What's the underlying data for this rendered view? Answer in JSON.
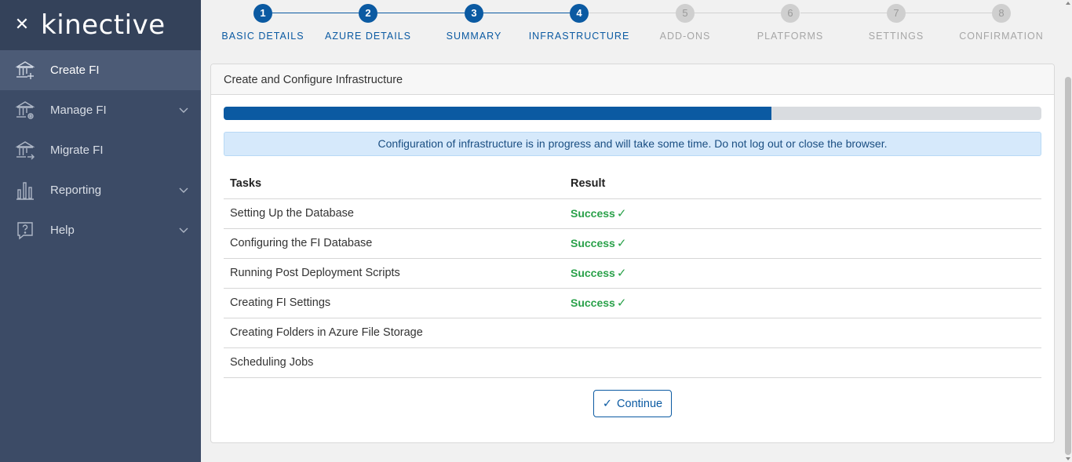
{
  "app": {
    "logo": "kinective"
  },
  "sidebar": {
    "items": [
      {
        "label": "Create FI",
        "icon": "bank-plus-icon",
        "active": true,
        "expandable": false
      },
      {
        "label": "Manage FI",
        "icon": "bank-gear-icon",
        "active": false,
        "expandable": true
      },
      {
        "label": "Migrate FI",
        "icon": "bank-arrow-icon",
        "active": false,
        "expandable": false
      },
      {
        "label": "Reporting",
        "icon": "bar-chart-icon",
        "active": false,
        "expandable": true
      },
      {
        "label": "Help",
        "icon": "help-bubble-icon",
        "active": false,
        "expandable": true
      }
    ]
  },
  "stepper": {
    "steps": [
      {
        "number": "1",
        "label": "BASIC DETAILS",
        "state": "done"
      },
      {
        "number": "2",
        "label": "AZURE DETAILS",
        "state": "done"
      },
      {
        "number": "3",
        "label": "SUMMARY",
        "state": "done"
      },
      {
        "number": "4",
        "label": "INFRASTRUCTURE",
        "state": "done"
      },
      {
        "number": "5",
        "label": "ADD-ONS",
        "state": "todo"
      },
      {
        "number": "6",
        "label": "PLATFORMS",
        "state": "todo"
      },
      {
        "number": "7",
        "label": "SETTINGS",
        "state": "todo"
      },
      {
        "number": "8",
        "label": "CONFIRMATION",
        "state": "todo"
      }
    ]
  },
  "card": {
    "title": "Create and Configure Infrastructure",
    "progress_fraction": 0.67,
    "alert": "Configuration of infrastructure is in progress and will take some time. Do not log out or close the browser.",
    "table": {
      "headers": {
        "task": "Tasks",
        "result": "Result"
      },
      "rows": [
        {
          "task": "Setting Up the Database",
          "result": "Success"
        },
        {
          "task": "Configuring the FI Database",
          "result": "Success"
        },
        {
          "task": "Running Post Deployment Scripts",
          "result": "Success"
        },
        {
          "task": "Creating FI Settings",
          "result": "Success"
        },
        {
          "task": "Creating Folders in Azure File Storage",
          "result": ""
        },
        {
          "task": "Scheduling Jobs",
          "result": ""
        }
      ]
    },
    "continue_label": "Continue"
  },
  "colors": {
    "primary": "#0b5aa2",
    "sidebar": "#3c4b66",
    "success": "#2aa14a"
  }
}
